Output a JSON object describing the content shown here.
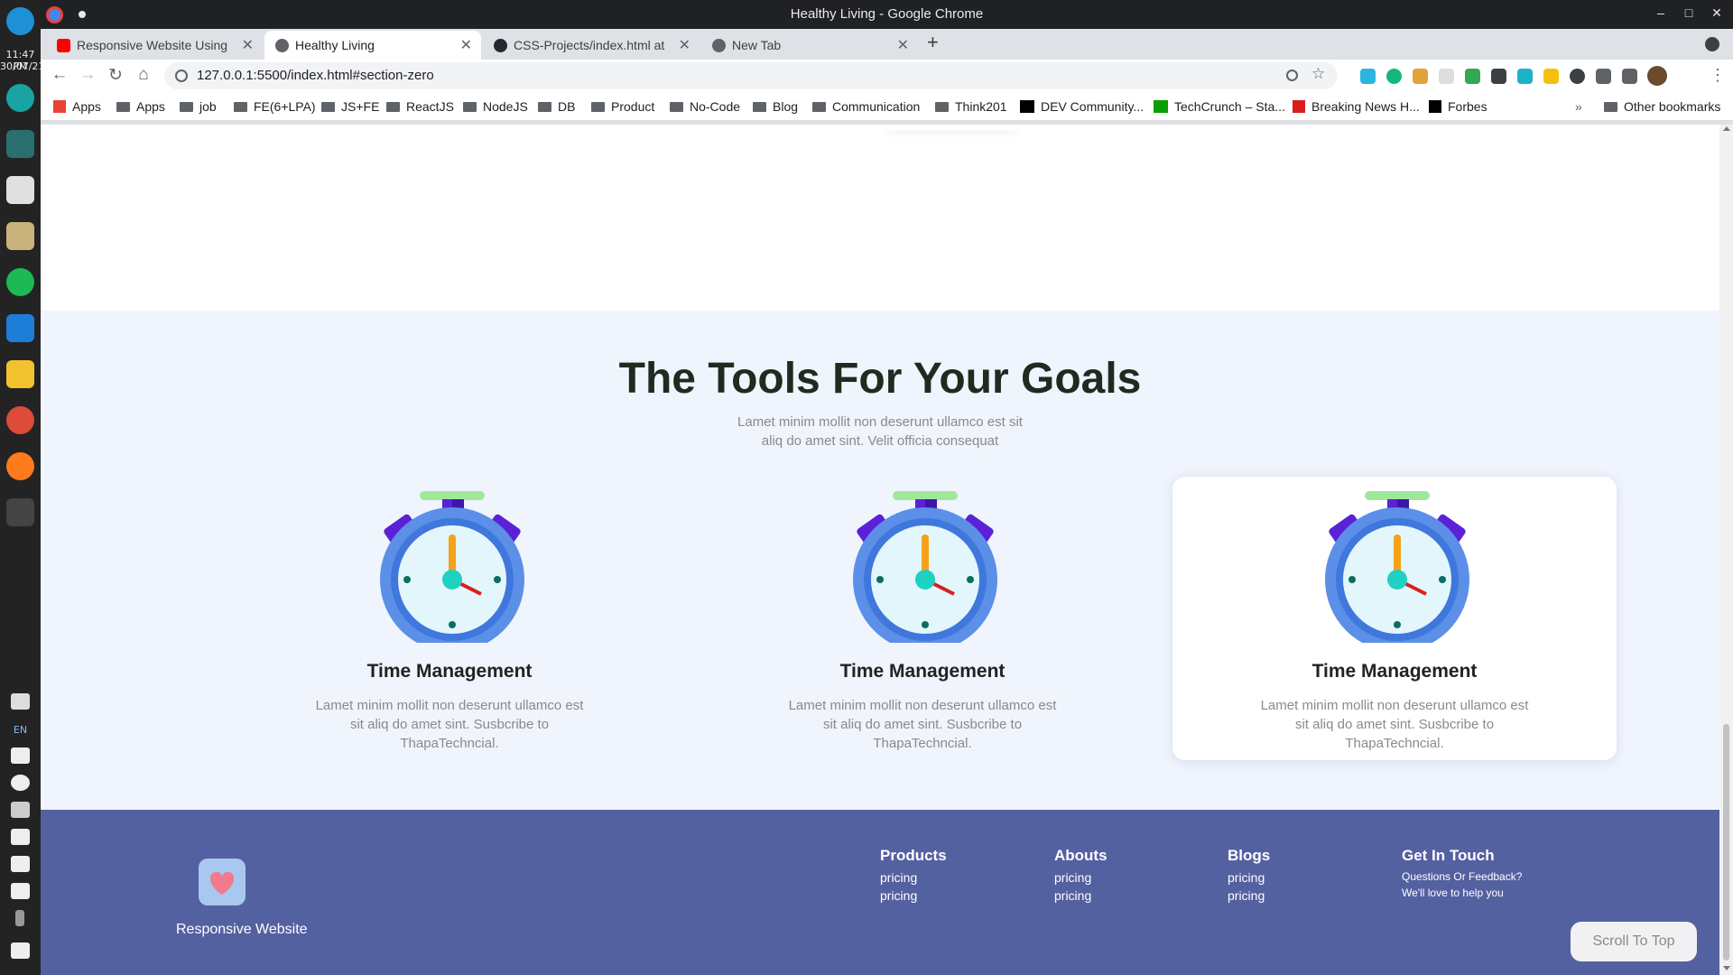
{
  "desktop": {
    "clock_time": "11:47 PM",
    "clock_date": "30/07/21",
    "lang": "EN"
  },
  "window": {
    "title": "Healthy Living - Google Chrome"
  },
  "tabs": [
    {
      "label": "Responsive Website Using"
    },
    {
      "label": "Healthy Living"
    },
    {
      "label": "CSS-Projects/index.html at m"
    },
    {
      "label": "New Tab"
    }
  ],
  "toolbar": {
    "url": "127.0.0.1:5500/index.html#section-zero"
  },
  "bookmarks": [
    {
      "label": "Apps"
    },
    {
      "label": "Apps"
    },
    {
      "label": "job"
    },
    {
      "label": "FE(6+LPA)"
    },
    {
      "label": "JS+FE"
    },
    {
      "label": "ReactJS"
    },
    {
      "label": "NodeJS"
    },
    {
      "label": "DB"
    },
    {
      "label": "Product"
    },
    {
      "label": "No-Code"
    },
    {
      "label": "Blog"
    },
    {
      "label": "Communication"
    },
    {
      "label": "Think201"
    },
    {
      "label": "DEV Community..."
    },
    {
      "label": "TechCrunch – Sta..."
    },
    {
      "label": "Breaking News H..."
    },
    {
      "label": "Forbes"
    },
    {
      "label": "Other bookmarks"
    }
  ],
  "tools": {
    "title": "The Tools For Your Goals",
    "subtitle": "Lamet minim mollit non deserunt ullamco est sit aliq do amet sint. Velit officia consequat",
    "cards": [
      {
        "title": "Time Management",
        "text": "Lamet minim mollit non deserunt ullamco est sit aliq do amet sint. Susbcribe to ThapaTechncial."
      },
      {
        "title": "Time Management",
        "text": "Lamet minim mollit non deserunt ullamco est sit aliq do amet sint. Susbcribe to ThapaTechncial."
      },
      {
        "title": "Time Management",
        "text": "Lamet minim mollit non deserunt ullamco est sit aliq do amet sint. Susbcribe to ThapaTechncial."
      }
    ]
  },
  "footer": {
    "brand": "Responsive Website",
    "columns": [
      {
        "heading": "Products",
        "links": [
          "pricing",
          "pricing"
        ]
      },
      {
        "heading": "Abouts",
        "links": [
          "pricing",
          "pricing"
        ]
      },
      {
        "heading": "Blogs",
        "links": [
          "pricing",
          "pricing"
        ]
      }
    ],
    "contact": {
      "heading": "Get In Touch",
      "line1": "Questions Or Feedback?",
      "line2": "We'll love to help you"
    },
    "scroll_top": "Scroll To Top"
  },
  "colors": {
    "footer_bg": "#5461a0",
    "section_bg": "#eff4fd",
    "clock_purple": "#5b21d6",
    "clock_blue": "#5b8fe8",
    "clock_face": "#e3f6fb",
    "clock_teal": "#1fd1c1",
    "clock_hand_orange": "#f5a21a",
    "clock_hand_red": "#d81f1f"
  }
}
